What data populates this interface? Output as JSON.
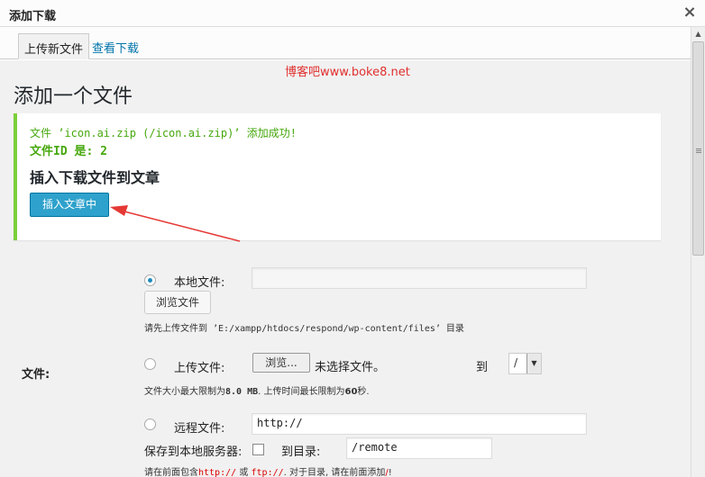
{
  "window": {
    "title": "添加下载",
    "close": "×"
  },
  "tabs": [
    {
      "label": "上传新文件"
    },
    {
      "label": "查看下载"
    }
  ],
  "watermark": "博客吧www.boke8.net",
  "page_title": "添加一个文件",
  "notice": {
    "line1": "文件 ’icon.ai.zip (/icon.ai.zip)’ 添加成功!",
    "line2": "文件ID 是: 2",
    "heading": "插入下载文件到文章",
    "insert_button": "插入文章中"
  },
  "form": {
    "file_label": "文件:",
    "local": {
      "label": "本地文件:",
      "value": "",
      "browse_button": "浏览文件",
      "hint": "请先上传文件到 ’E:/xampp/htdocs/respond/wp-content/files’ 目录"
    },
    "upload": {
      "label": "上传文件:",
      "browse_button": "浏览...",
      "no_file": "未选择文件。",
      "to_label": "到",
      "dir_value": "/",
      "dir_arrow": "▼",
      "hint_pre": "文件大小最大限制为",
      "hint_size": "8.0 MB",
      "hint_mid": ". 上传时间最长限制为",
      "hint_time": "60",
      "hint_post": "秒."
    },
    "remote": {
      "label": "远程文件:",
      "value": "http://",
      "save_local_label": "保存到本地服务器:",
      "to_dir_label": "到目录:",
      "dir_value": "/remote",
      "hint_pre": "请在前面包含",
      "hint_http": "http://",
      "hint_or": " 或 ",
      "hint_ftp": "ftp://",
      "hint_mid": ". 对于目录, 请在前面添加",
      "hint_slash": "/",
      "hint_post": "!"
    }
  },
  "colors": {
    "accent": "#2ea2cc",
    "success": "#7ad03a",
    "watermark": "#e0302f",
    "link": "#0073aa"
  },
  "icons": {
    "close": "close-icon",
    "scroll_up": "scroll-up-arrow-icon"
  }
}
